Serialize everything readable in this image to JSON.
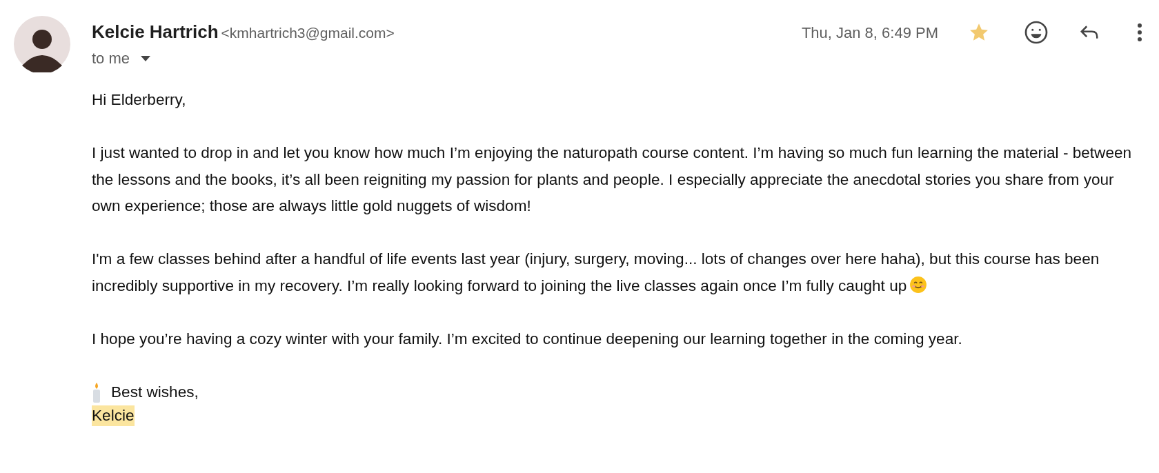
{
  "sender": {
    "name": "Kelcie Hartrich",
    "email": "<kmhartrich3@gmail.com>",
    "recipient": "to me"
  },
  "date": "Thu, Jan 8, 6:49 PM",
  "starred": true,
  "body": {
    "greeting": "Hi Elderberry,",
    "paragraphs": [
      {
        "text": "I just wanted to drop in and let you know how much I’m enjoying the naturopath course content. I’m having so much fun learning the material - between the lessons and the books, it’s all been reigniting my passion for plants and people. I especially appreciate the anecdotal stories you share from your own experience; those are always little gold nuggets of wisdom!",
        "emoji": false
      },
      {
        "text": "I'm a few classes behind after a handful of life events last year (injury, surgery, moving... lots of changes over here haha), but this course has been incredibly supportive in my recovery. I’m really looking forward to joining the live classes again once I’m fully caught up",
        "emoji": true
      },
      {
        "text": "I hope you’re having a cozy winter with your family. I’m excited to continue deepening our learning together in the coming year.",
        "emoji": false
      }
    ],
    "closing": "Best wishes,",
    "signature": {
      "text": "Kelcie",
      "highlighted": true
    }
  }
}
